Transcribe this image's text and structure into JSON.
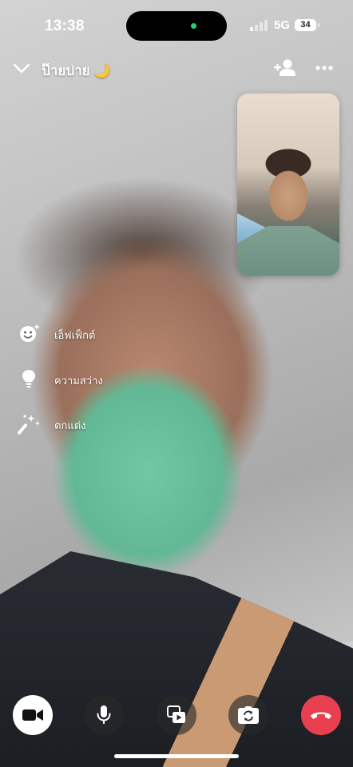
{
  "status_bar": {
    "time": "13:38",
    "network": "5G",
    "battery": "34",
    "signal_bars_active": 1,
    "signal_bars_total": 4,
    "island_indicator_color": "#2ecc71"
  },
  "header": {
    "title": "ป๊ายปาย 🌙",
    "collapse_icon": "chevron-down-icon",
    "add_person_icon": "add-person-icon",
    "more_icon": "more-icon"
  },
  "side_menu": {
    "items": [
      {
        "label": "เอ็ฟเฟ็กต์",
        "icon": "effects-icon"
      },
      {
        "label": "ความสว่าง",
        "icon": "brightness-icon"
      },
      {
        "label": "ตกแต่ง",
        "icon": "touch-up-icon"
      }
    ]
  },
  "controls": {
    "buttons": [
      {
        "name": "video-toggle",
        "icon": "video-camera-icon",
        "state": "on"
      },
      {
        "name": "microphone",
        "icon": "microphone-icon"
      },
      {
        "name": "share-media",
        "icon": "media-share-icon"
      },
      {
        "name": "flip-camera",
        "icon": "flip-camera-icon"
      },
      {
        "name": "end-call",
        "icon": "end-call-icon"
      }
    ]
  },
  "colors": {
    "end_call": "#e8404f",
    "control_dark": "#282828",
    "control_light": "#ffffff"
  }
}
